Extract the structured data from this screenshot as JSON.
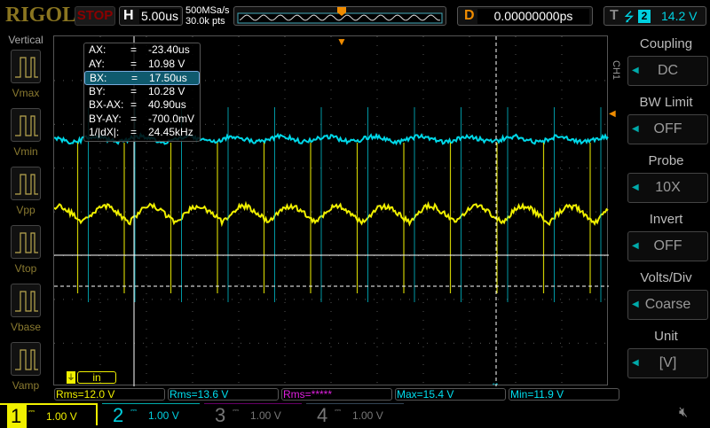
{
  "header": {
    "logo": "RIGOL",
    "run_state": "STOP",
    "h_label": "H",
    "timebase": "5.00us",
    "sample_rate": "500MSa/s",
    "memory_depth": "30.0k pts",
    "d_label": "D",
    "delay": "0.00000000ps",
    "t_label": "T",
    "trigger_source": "2",
    "trigger_level": "14.2 V"
  },
  "left_panel": {
    "title": "Vertical",
    "items": [
      "Vmax",
      "Vmin",
      "Vpp",
      "Vtop",
      "Vbase",
      "Vamp"
    ]
  },
  "cursor_readout": [
    {
      "label": "AX:",
      "eq": "=",
      "value": "-23.40us"
    },
    {
      "label": "AY:",
      "eq": "=",
      "value": "10.98 V"
    },
    {
      "label": "BX:",
      "eq": "=",
      "value": "17.50us"
    },
    {
      "label": "BY:",
      "eq": "=",
      "value": "10.28 V"
    },
    {
      "label": "BX-AX:",
      "eq": "=",
      "value": "40.90us"
    },
    {
      "label": "BY-AY:",
      "eq": "=",
      "value": "-700.0mV"
    },
    {
      "label": "1/|dX|:",
      "eq": "=",
      "value": "24.45kHz"
    }
  ],
  "menu": {
    "channel_tag": "CH1",
    "items": [
      {
        "title": "Coupling",
        "value": "DC"
      },
      {
        "title": "BW Limit",
        "value": "OFF"
      },
      {
        "title": "Probe",
        "value": "10X"
      },
      {
        "title": "Invert",
        "value": "OFF"
      },
      {
        "title": "Volts/Div",
        "value": "Coarse"
      },
      {
        "title": "Unit",
        "value": "[V]"
      }
    ]
  },
  "input_label": "in",
  "measurements": [
    {
      "text": "Rms=12.0 V",
      "color": "#f0f000"
    },
    {
      "text": "Rms=13.6 V",
      "color": "#00e0f0"
    },
    {
      "text": "Rms=*****",
      "color": "#e020e0"
    },
    {
      "text": "Max=15.4 V",
      "color": "#00e0f0"
    },
    {
      "text": "Min=11.9 V",
      "color": "#00e0f0"
    }
  ],
  "channels": [
    {
      "num": "1",
      "scale": "1.00 V",
      "color": "#f0f000"
    },
    {
      "num": "2",
      "scale": "1.00 V",
      "color": "#00d0e0"
    },
    {
      "num": "3",
      "scale": "1.00 V",
      "color": "#777"
    },
    {
      "num": "4",
      "scale": "1.00 V",
      "color": "#777"
    }
  ],
  "colors": {
    "ch1": "#f0f000",
    "ch2": "#00d8e8",
    "trigger": "#f08c00"
  }
}
